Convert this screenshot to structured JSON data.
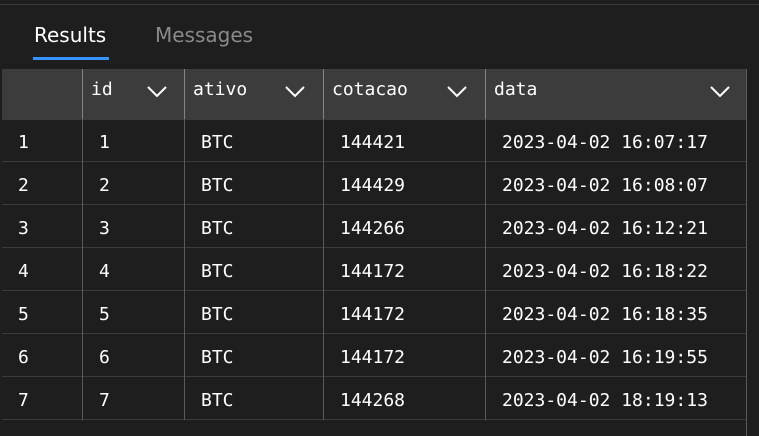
{
  "tabs": {
    "results": "Results",
    "messages": "Messages"
  },
  "columns": [
    "id",
    "ativo",
    "cotacao",
    "data"
  ],
  "rows": [
    {
      "row_num": "1",
      "id": "1",
      "ativo": "BTC",
      "cotacao": "144421",
      "data": "2023-04-02 16:07:17"
    },
    {
      "row_num": "2",
      "id": "2",
      "ativo": "BTC",
      "cotacao": "144429",
      "data": "2023-04-02 16:08:07"
    },
    {
      "row_num": "3",
      "id": "3",
      "ativo": "BTC",
      "cotacao": "144266",
      "data": "2023-04-02 16:12:21"
    },
    {
      "row_num": "4",
      "id": "4",
      "ativo": "BTC",
      "cotacao": "144172",
      "data": "2023-04-02 16:18:22"
    },
    {
      "row_num": "5",
      "id": "5",
      "ativo": "BTC",
      "cotacao": "144172",
      "data": "2023-04-02 16:18:35"
    },
    {
      "row_num": "6",
      "id": "6",
      "ativo": "BTC",
      "cotacao": "144172",
      "data": "2023-04-02 16:19:55"
    },
    {
      "row_num": "7",
      "id": "7",
      "ativo": "BTC",
      "cotacao": "144268",
      "data": "2023-04-02 18:19:13"
    }
  ],
  "colors": {
    "background": "#1e1e1e",
    "header": "#3c3c3c",
    "accent": "#3794ff",
    "inactive_tab": "#8a8a8a"
  },
  "icons": {
    "column_menu": "chevron-down-icon"
  }
}
